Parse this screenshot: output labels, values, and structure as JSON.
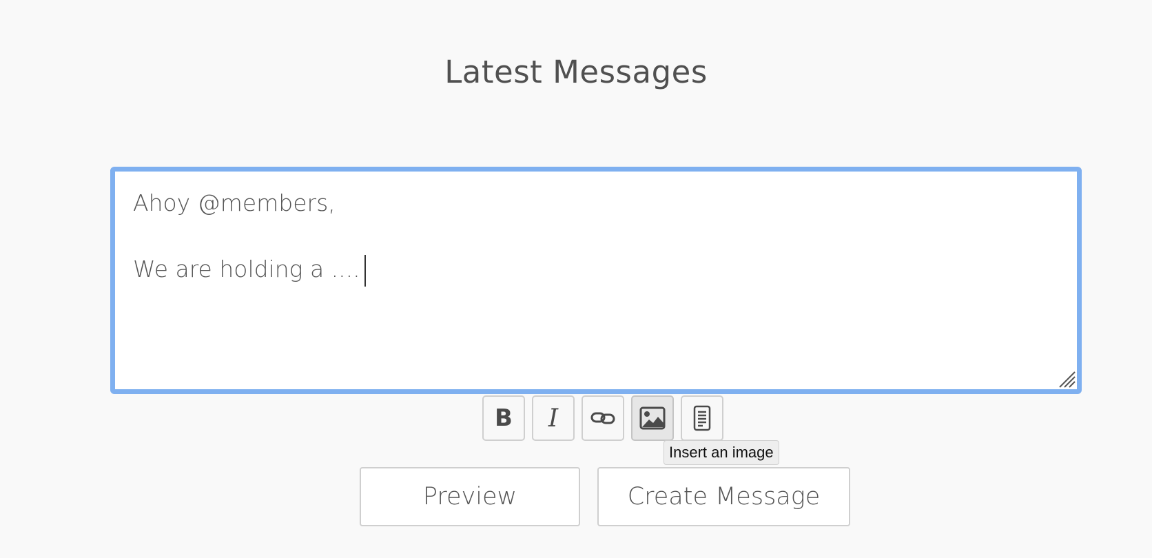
{
  "page": {
    "title": "Latest Messages"
  },
  "editor": {
    "lines": [
      "Ahoy @members,",
      "",
      "We are holding a ...."
    ],
    "focus_color": "#7fb0f0"
  },
  "toolbar": {
    "buttons": [
      {
        "name": "bold",
        "icon": "bold-icon",
        "glyph": "B"
      },
      {
        "name": "italic",
        "icon": "italic-icon",
        "glyph": "I"
      },
      {
        "name": "link",
        "icon": "link-icon"
      },
      {
        "name": "image",
        "icon": "image-icon",
        "active": true
      },
      {
        "name": "document",
        "icon": "document-icon"
      }
    ],
    "tooltip": "Insert an image"
  },
  "actions": {
    "preview_label": "Preview",
    "create_label": "Create Message"
  }
}
